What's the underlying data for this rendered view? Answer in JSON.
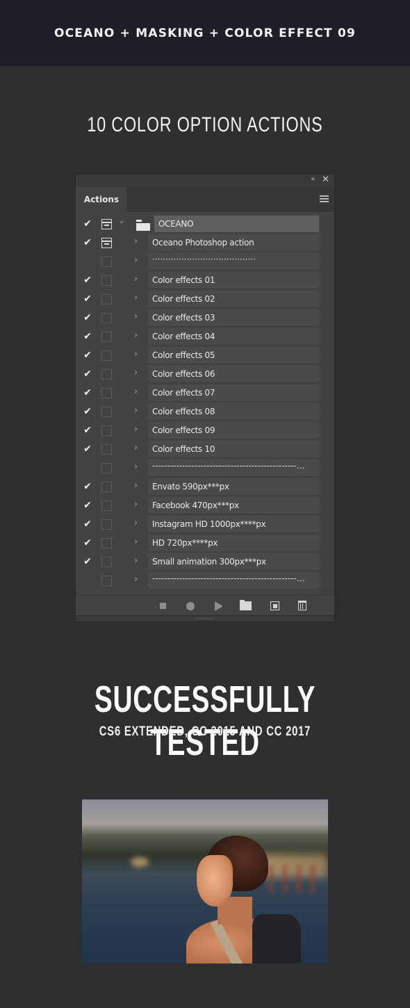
{
  "banner": {
    "title": "OCEANO + MASKING + COLOR EFFECT 09"
  },
  "section_heading": "10 COLOR OPTION ACTIONS",
  "actions_panel": {
    "tab_label": "Actions",
    "collapse_icon": "«",
    "close_icon": "✕",
    "menu_icon": "hamburger-menu",
    "rows": [
      {
        "checked": true,
        "dialog": true,
        "type": "set",
        "expanded": true,
        "label": "OCEANO"
      },
      {
        "checked": true,
        "dialog": true,
        "type": "action",
        "label": "Oceano Photoshop action"
      },
      {
        "checked": false,
        "dialog": false,
        "type": "action",
        "label": "·······································"
      },
      {
        "checked": true,
        "dialog": false,
        "type": "action",
        "label": "Color effects 01"
      },
      {
        "checked": true,
        "dialog": false,
        "type": "action",
        "label": "Color effects 02"
      },
      {
        "checked": true,
        "dialog": false,
        "type": "action",
        "label": "Color effects 03"
      },
      {
        "checked": true,
        "dialog": false,
        "type": "action",
        "label": "Color effects 04"
      },
      {
        "checked": true,
        "dialog": false,
        "type": "action",
        "label": "Color effects 05"
      },
      {
        "checked": true,
        "dialog": false,
        "type": "action",
        "label": "Color effects 06"
      },
      {
        "checked": true,
        "dialog": false,
        "type": "action",
        "label": "Color effects 07"
      },
      {
        "checked": true,
        "dialog": false,
        "type": "action",
        "label": "Color effects 08"
      },
      {
        "checked": true,
        "dialog": false,
        "type": "action",
        "label": "Color effects 09"
      },
      {
        "checked": true,
        "dialog": false,
        "type": "action",
        "label": "Color effects 10"
      },
      {
        "checked": false,
        "dialog": false,
        "type": "action",
        "label": "------------------------------------------------…"
      },
      {
        "checked": true,
        "dialog": false,
        "type": "action",
        "label": "Envato 590px***px"
      },
      {
        "checked": true,
        "dialog": false,
        "type": "action",
        "label": "Facebook 470px***px"
      },
      {
        "checked": true,
        "dialog": false,
        "type": "action",
        "label": "Instagram HD 1000px****px"
      },
      {
        "checked": true,
        "dialog": false,
        "type": "action",
        "label": "HD 720px****px"
      },
      {
        "checked": true,
        "dialog": false,
        "type": "action",
        "label": "Small animation 300px***px"
      },
      {
        "checked": false,
        "dialog": false,
        "type": "action",
        "label": "------------------------------------------------…"
      }
    ],
    "toolbar": [
      "stop-icon",
      "record-icon",
      "play-icon",
      "new-set-icon",
      "new-action-icon",
      "trash-icon"
    ]
  },
  "tested": {
    "title": "SUCCESSFULLY TESTED",
    "subtitle": "CS6 EXTENDED, CC 2015 AND CC 2017"
  },
  "photo": {
    "description": "woman by lake at sunset"
  },
  "colors": {
    "banner_bg": "#1f2027",
    "page_bg": "#2f2f31",
    "panel_bg": "#434343",
    "set_row_bg": "#5f5f5f"
  }
}
